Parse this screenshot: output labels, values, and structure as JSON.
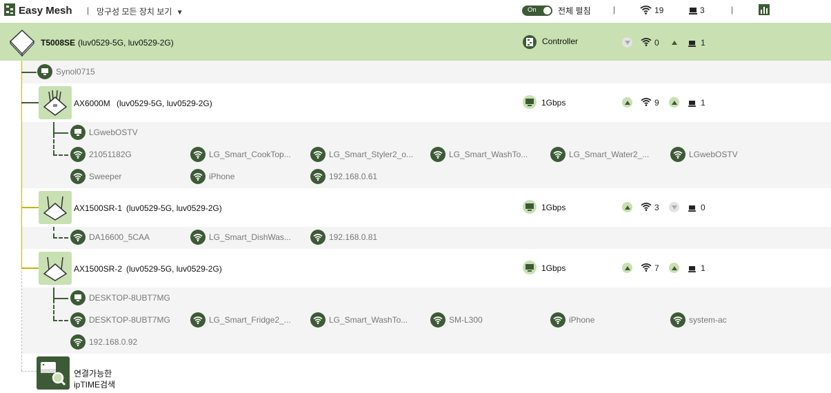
{
  "header": {
    "brand": "Easy Mesh",
    "view_dropdown": "망구성 모든 장치 보기",
    "dropdown_arrow": "▼",
    "toggle_label": "On",
    "expand_all": "전체 펼침",
    "wifi_count": "19",
    "wired_count": "3",
    "sep": "|"
  },
  "controller": {
    "name": "T5008SE",
    "ssids": "(luv0529-5G, luv0529-2G)",
    "role": "Controller",
    "wifi": "0",
    "wired": "1"
  },
  "controller_wired_device": "Synol0715",
  "nodes": [
    {
      "name": "AX6000M",
      "ssids": "(luv0529-5G, luv0529-2G)",
      "speed": "1Gbps",
      "wifi": "9",
      "wired": "1",
      "wired_devices": [
        "LGwebOSTV"
      ],
      "wifi_devices": [
        "21051182G",
        "LG_Smart_CookTop...",
        "LG_Smart_Styler2_o...",
        "LG_Smart_WashTo...",
        "LG_Smart_Water2_...",
        "LGwebOSTV",
        "Sweeper",
        "iPhone",
        "192.168.0.61"
      ]
    },
    {
      "name": "AX1500SR-1",
      "ssids": "(luv0529-5G, luv0529-2G)",
      "speed": "1Gbps",
      "wifi": "3",
      "wired": "0",
      "wired_devices": [],
      "wifi_devices": [
        "DA16600_5CAA",
        "LG_Smart_DishWas...",
        "192.168.0.81"
      ]
    },
    {
      "name": "AX1500SR-2",
      "ssids": "(luv0529-5G, luv0529-2G)",
      "speed": "1Gbps",
      "wifi": "7",
      "wired": "1",
      "wired_devices": [
        "DESKTOP-8UBT7MG"
      ],
      "wifi_devices": [
        "DESKTOP-8UBT7MG",
        "LG_Smart_Fridge2_...",
        "LG_Smart_WashTo...",
        "SM-L300",
        "iPhone",
        "system-ac",
        "192.168.0.92"
      ]
    }
  ],
  "search": {
    "line1": "연결가능한",
    "line2": "ipTIME검색"
  },
  "colors": {
    "dark_green": "#3d5a36",
    "light_green": "#c8e0b2",
    "gray_bg": "#f4f4f4"
  }
}
